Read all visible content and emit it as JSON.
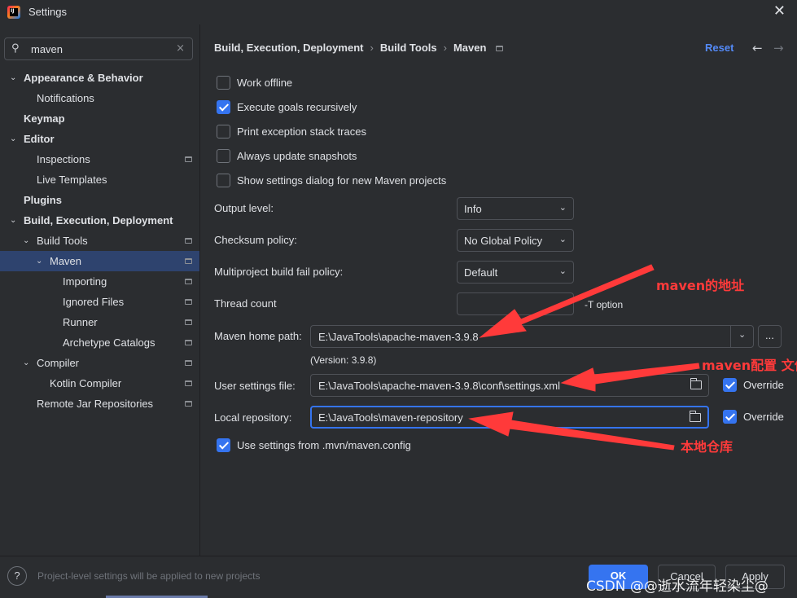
{
  "window": {
    "title": "Settings",
    "close": "✕",
    "app_icon": "intellij-idea-icon"
  },
  "search": {
    "value": "maven",
    "icon": "⚲",
    "clear": "×"
  },
  "sidebar": {
    "items": [
      {
        "label": "Appearance & Behavior",
        "level": 0,
        "bold": true,
        "expanded": true
      },
      {
        "label": "Notifications",
        "level": 1
      },
      {
        "label": "Keymap",
        "level": 0,
        "bold": true
      },
      {
        "label": "Editor",
        "level": 0,
        "bold": true,
        "expanded": true
      },
      {
        "label": "Inspections",
        "level": 1,
        "project": true
      },
      {
        "label": "Live Templates",
        "level": 1
      },
      {
        "label": "Plugins",
        "level": 0,
        "bold": true
      },
      {
        "label": "Build, Execution, Deployment",
        "level": 0,
        "bold": true,
        "expanded": true
      },
      {
        "label": "Build Tools",
        "level": 1,
        "expanded": true,
        "project": true
      },
      {
        "label": "Maven",
        "level": 2,
        "expanded": true,
        "project": true,
        "selected": true
      },
      {
        "label": "Importing",
        "level": 3,
        "project": true
      },
      {
        "label": "Ignored Files",
        "level": 3,
        "project": true
      },
      {
        "label": "Runner",
        "level": 3,
        "project": true
      },
      {
        "label": "Archetype Catalogs",
        "level": 3,
        "project": true
      },
      {
        "label": "Compiler",
        "level": 1,
        "expanded": true,
        "project": true
      },
      {
        "label": "Kotlin Compiler",
        "level": 2,
        "project": true
      },
      {
        "label": "Remote Jar Repositories",
        "level": 1,
        "project": true
      }
    ]
  },
  "header": {
    "breadcrumb": [
      "Build, Execution, Deployment",
      "Build Tools",
      "Maven"
    ],
    "separator": "›",
    "reset": "Reset",
    "back": "←",
    "forward": "→"
  },
  "checkboxes": {
    "work_offline": {
      "label": "Work offline",
      "checked": false
    },
    "execute_goals": {
      "label": "Execute goals recursively",
      "checked": true
    },
    "print_exception": {
      "label": "Print exception stack traces",
      "checked": false
    },
    "always_update": {
      "label": "Always update snapshots",
      "checked": false
    },
    "show_settings": {
      "label": "Show settings dialog for new Maven projects",
      "checked": false
    },
    "use_mvn_config": {
      "label": "Use settings from .mvn/maven.config",
      "checked": true
    }
  },
  "form": {
    "output_level": {
      "label": "Output level:",
      "value": "Info"
    },
    "checksum_policy": {
      "label": "Checksum policy:",
      "value": "No Global Policy"
    },
    "multiproject_policy": {
      "label": "Multiproject build fail policy:",
      "value": "Default"
    },
    "thread_count": {
      "label": "Thread count",
      "value": "",
      "suffix": "-T option"
    },
    "maven_home": {
      "label": "Maven home path:",
      "value": "E:\\JavaTools\\apache-maven-3.9.8",
      "browse": "...",
      "version": "(Version: 3.9.8)"
    },
    "user_settings": {
      "label": "User settings file:",
      "value": "E:\\JavaTools\\apache-maven-3.9.8\\conf\\settings.xml",
      "override_label": "Override",
      "override_checked": true
    },
    "local_repo": {
      "label": "Local repository:",
      "value": "E:\\JavaTools\\maven-repository",
      "override_label": "Override",
      "override_checked": true
    }
  },
  "annotations": {
    "maven_address": "maven的地址",
    "maven_config": "maven配置 文件",
    "local_repo": "本地仓库",
    "color": "#ff3a3a"
  },
  "footer": {
    "help": "?",
    "hint": "Project-level settings will be applied to new projects",
    "ok": "OK",
    "cancel": "Cancel",
    "apply": "Apply",
    "watermark": "CSDN @@逝水流年轻染尘@"
  },
  "colors": {
    "accent": "#3574f0",
    "selected": "#2e436e",
    "link": "#548af7",
    "background": "#2b2d30"
  }
}
